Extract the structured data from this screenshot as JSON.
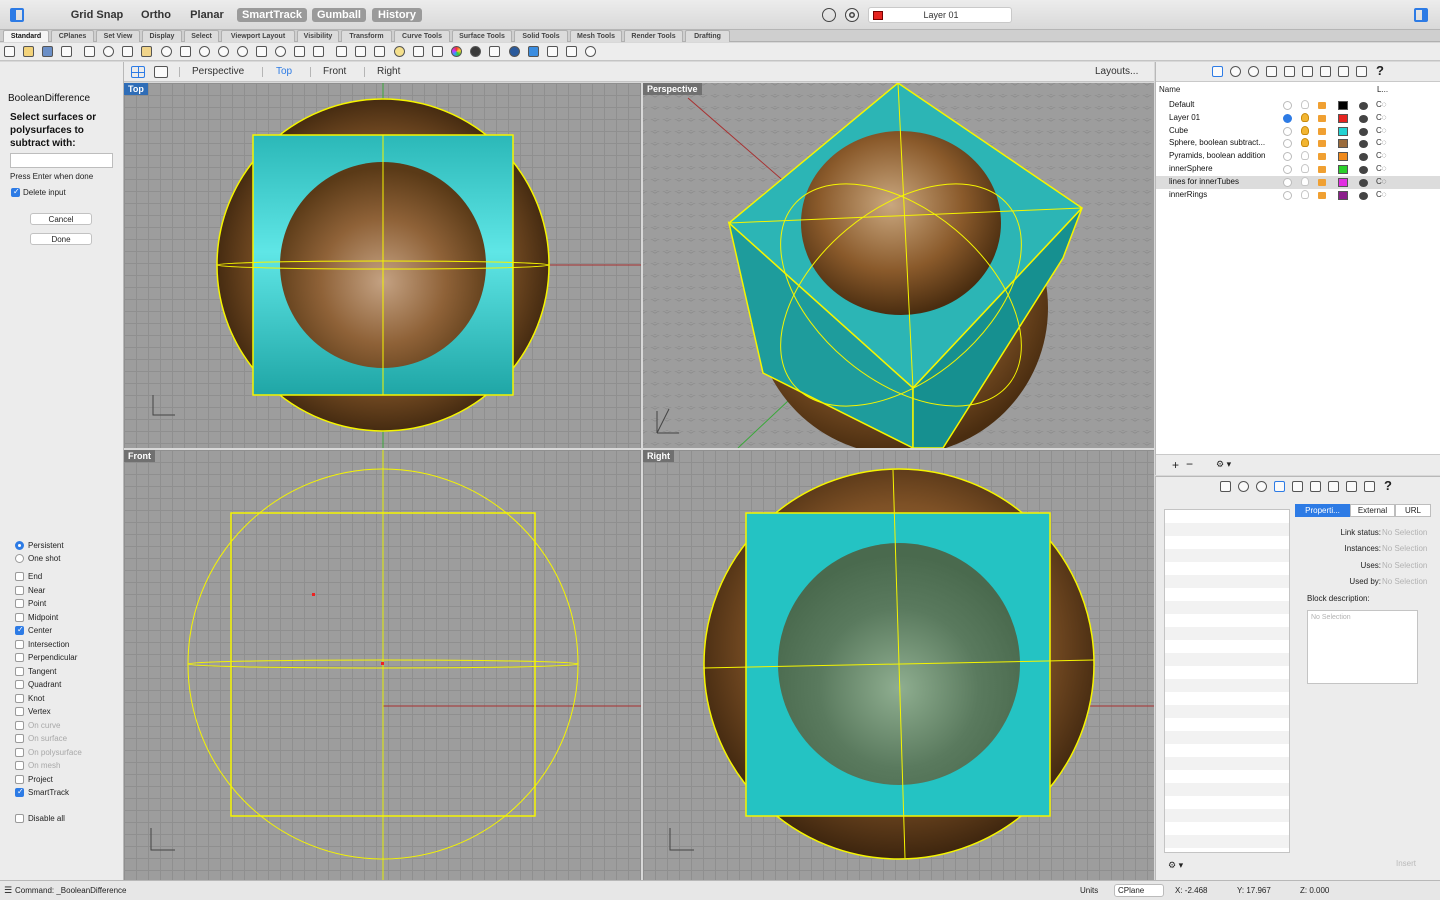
{
  "topbar": {
    "modes": [
      "Grid Snap",
      "Ortho",
      "Planar",
      "SmartTrack",
      "Gumball",
      "History"
    ],
    "current_layer": "Layer 01",
    "current_layer_color": "#e52420"
  },
  "tabs": [
    "Standard",
    "CPlanes",
    "Set View",
    "Display",
    "Select",
    "Viewport Layout",
    "Visibility",
    "Transform",
    "Curve Tools",
    "Surface Tools",
    "Solid Tools",
    "Mesh Tools",
    "Render Tools",
    "Drafting"
  ],
  "command": {
    "name": "BooleanDifference",
    "prompt": "Select surfaces or polysurfaces to subtract with:",
    "input_value": "",
    "hint": "Press Enter when done",
    "delete_input_label": "Delete input",
    "cancel_label": "Cancel",
    "done_label": "Done"
  },
  "osnap": {
    "modes": [
      "Persistent",
      "One shot"
    ],
    "items": [
      {
        "label": "End",
        "checked": false,
        "enabled": true
      },
      {
        "label": "Near",
        "checked": false,
        "enabled": true
      },
      {
        "label": "Point",
        "checked": false,
        "enabled": true
      },
      {
        "label": "Midpoint",
        "checked": false,
        "enabled": true
      },
      {
        "label": "Center",
        "checked": true,
        "enabled": true
      },
      {
        "label": "Intersection",
        "checked": false,
        "enabled": true
      },
      {
        "label": "Perpendicular",
        "checked": false,
        "enabled": true
      },
      {
        "label": "Tangent",
        "checked": false,
        "enabled": true
      },
      {
        "label": "Quadrant",
        "checked": false,
        "enabled": true
      },
      {
        "label": "Knot",
        "checked": false,
        "enabled": true
      },
      {
        "label": "Vertex",
        "checked": false,
        "enabled": true
      },
      {
        "label": "On curve",
        "checked": false,
        "enabled": false
      },
      {
        "label": "On surface",
        "checked": false,
        "enabled": false
      },
      {
        "label": "On polysurface",
        "checked": false,
        "enabled": false
      },
      {
        "label": "On mesh",
        "checked": false,
        "enabled": false
      },
      {
        "label": "Project",
        "checked": false,
        "enabled": true
      },
      {
        "label": "SmartTrack",
        "checked": true,
        "enabled": true
      }
    ],
    "disable_all_label": "Disable all"
  },
  "viewport_tabs": [
    "Perspective",
    "Top",
    "Front",
    "Right"
  ],
  "layouts_label": "Layouts...",
  "viewports": {
    "top": "Top",
    "perspective": "Perspective",
    "front": "Front",
    "right": "Right"
  },
  "layers": {
    "header_name": "Name",
    "header_linetype": "L...",
    "rows": [
      {
        "name": "Default",
        "color": "#000000",
        "current": false,
        "on": false
      },
      {
        "name": "Layer 01",
        "color": "#e52420",
        "current": true,
        "on": true
      },
      {
        "name": "Cube",
        "color": "#23d3d3",
        "current": false,
        "on": true
      },
      {
        "name": "Sphere, boolean subtract...",
        "color": "#9a6b3c",
        "current": false,
        "on": true
      },
      {
        "name": "Pyramids, boolean addition",
        "color": "#f08a1c",
        "current": false,
        "on": false
      },
      {
        "name": "innerSphere",
        "color": "#2bd12b",
        "current": false,
        "on": false
      },
      {
        "name": "lines for innerTubes",
        "color": "#e22fe2",
        "current": false,
        "on": false
      },
      {
        "name": "innerRings",
        "color": "#8b1f8b",
        "current": false,
        "on": false
      }
    ]
  },
  "properties": {
    "tabs": [
      "Properti...",
      "External",
      "URL"
    ],
    "fields": [
      {
        "key": "Link status:",
        "value": "No Selection"
      },
      {
        "key": "Instances:",
        "value": "No Selection"
      },
      {
        "key": "Uses:",
        "value": "No Selection"
      },
      {
        "key": "Used by:",
        "value": "No Selection"
      }
    ],
    "block_description_label": "Block description:",
    "block_description_value": "No Selection",
    "insert_label": "Insert"
  },
  "status": {
    "command_line": "Command: _BooleanDifference",
    "units_label": "Units",
    "cplane": "CPlane",
    "x": "X: -2.468",
    "y": "Y: 17.967",
    "z": "Z: 0.000"
  },
  "colors": {
    "cube": "#2fcece",
    "sphere": "#8a5a2b",
    "highlight": "#f5f500",
    "active_blue": "#2d7be5"
  }
}
